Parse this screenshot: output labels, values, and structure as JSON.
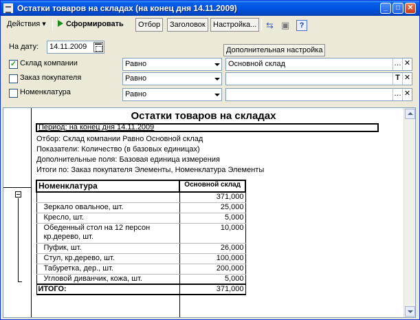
{
  "window": {
    "title": "Остатки товаров на складах (на конец дня 14.11.2009)"
  },
  "toolbar": {
    "actions_label": "Действия",
    "generate_label": "Сформировать",
    "filter_label": "Отбор",
    "header_label": "Заголовок",
    "settings_label": "Настройка..."
  },
  "form": {
    "date_label": "На дату:",
    "date_value": "14.11.2009",
    "tooltip": "Дополнительная настройка",
    "filters": [
      {
        "label": "Склад компании",
        "checked": true,
        "condition": "Равно",
        "value": "Основной склад"
      },
      {
        "label": "Заказ покупателя",
        "checked": false,
        "condition": "Равно",
        "value": ""
      },
      {
        "label": "Номенклатура",
        "checked": false,
        "condition": "Равно",
        "value": ""
      }
    ]
  },
  "report": {
    "title": "Остатки товаров на складах",
    "period": "Период: на конец дня 14.11.2009",
    "filter_line": "Отбор: Склад компании Равно Основной склад",
    "indicators_line": "Показатели:  Количество (в базовых единицах)",
    "extra_fields_line": "Дополнительные поля:  Базовая единица измерения",
    "totals_by_line": "Итоги по:  Заказ покупателя Элементы, Номенклатура Элементы",
    "columns": [
      "Номенклатура",
      "Основной склад"
    ],
    "group_total": "371,000",
    "rows": [
      {
        "name": "Зеркало овальное, шт.",
        "qty": "25,000"
      },
      {
        "name": "Кресло, шт.",
        "qty": "5,000"
      },
      {
        "name": "Обеденный стол на 12 персон кр.дерево, шт.",
        "qty": "10,000"
      },
      {
        "name": "Пуфик, шт.",
        "qty": "26,000"
      },
      {
        "name": "Стул, кр.дерево, шт.",
        "qty": "100,000"
      },
      {
        "name": "Табуретка, дер., шт.",
        "qty": "200,000"
      },
      {
        "name": "Угловой диванчик, кожа, шт.",
        "qty": "5,000"
      }
    ],
    "total_label": "ИТОГО:",
    "total_value": "371,000"
  }
}
